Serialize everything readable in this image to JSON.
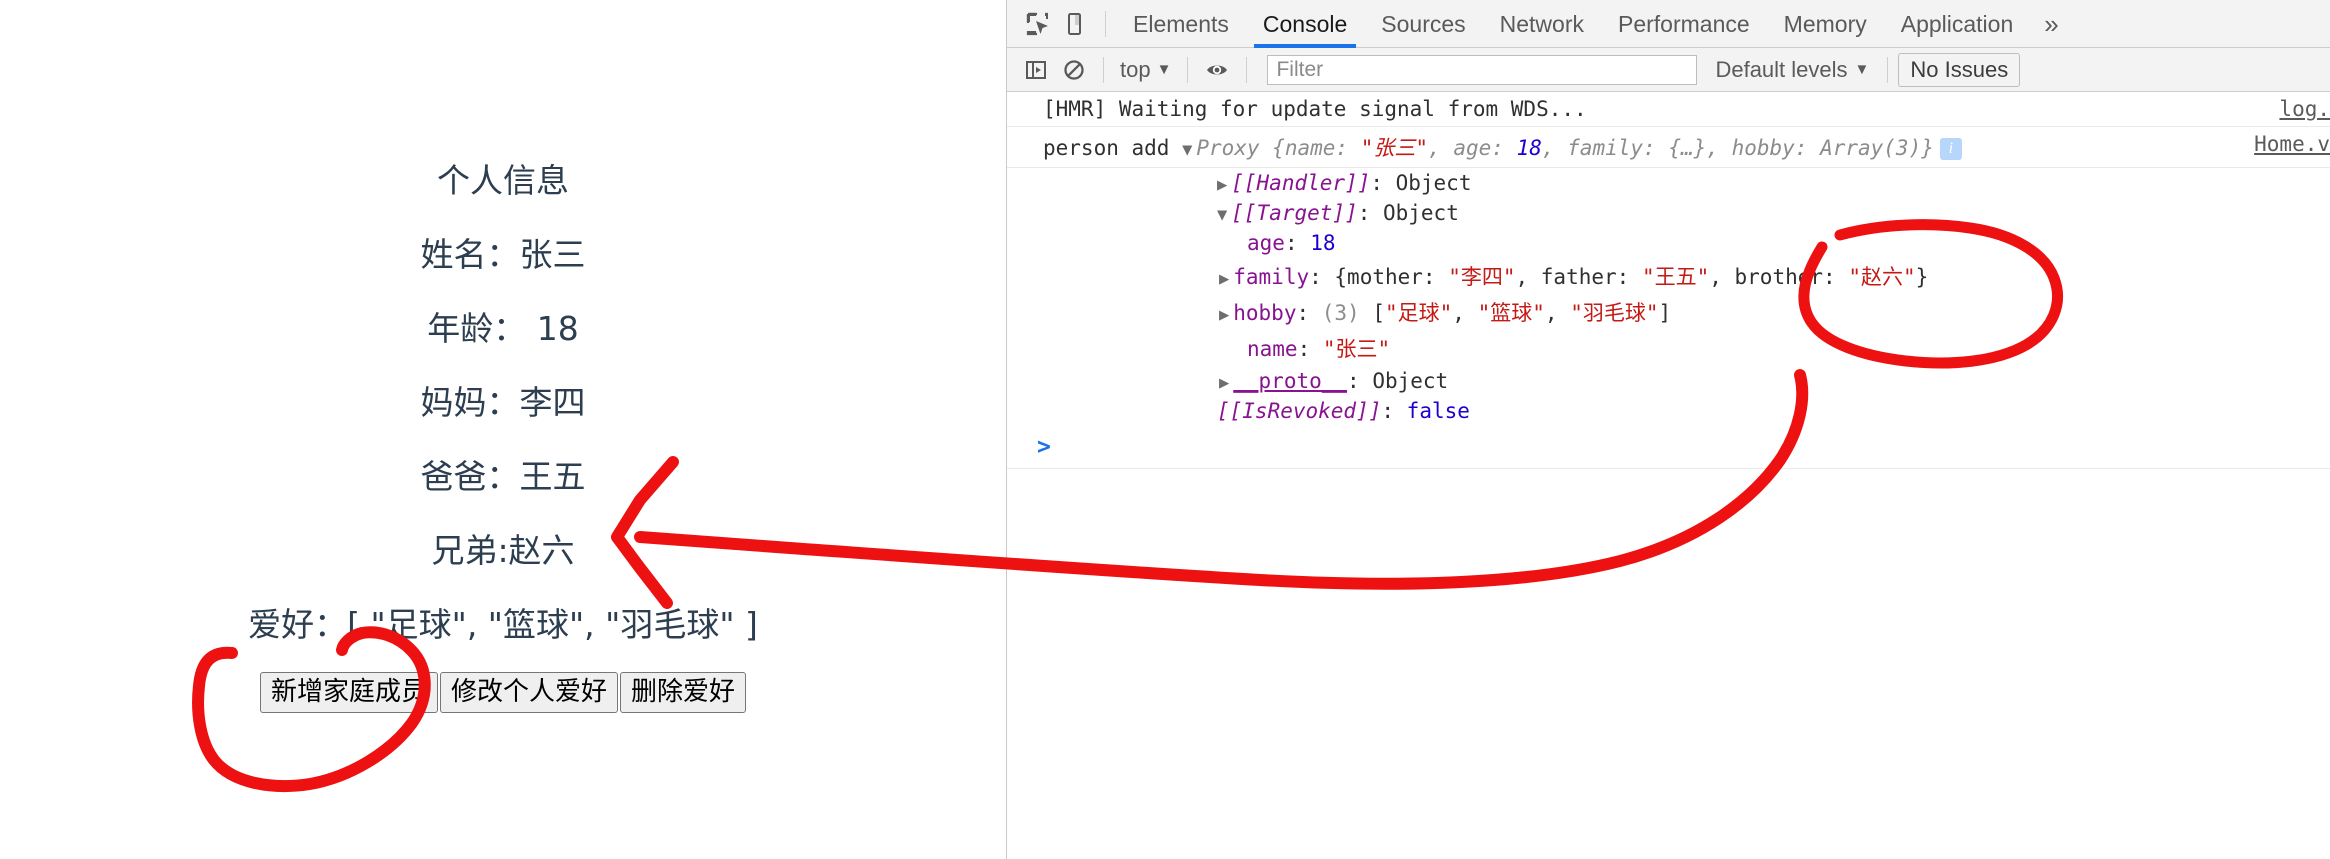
{
  "page": {
    "title": "个人信息",
    "rows": [
      "姓名：张三",
      "年龄： 18",
      "妈妈：李四",
      "爸爸：王五",
      "兄弟:赵六",
      "爱好：[ \"足球\", \"篮球\", \"羽毛球\" ]"
    ],
    "buttons": [
      "新增家庭成员",
      "修改个人爱好",
      "删除爱好"
    ]
  },
  "devtools": {
    "tabs": [
      {
        "label": "Elements",
        "active": false
      },
      {
        "label": "Console",
        "active": true
      },
      {
        "label": "Sources",
        "active": false
      },
      {
        "label": "Network",
        "active": false
      },
      {
        "label": "Performance",
        "active": false
      },
      {
        "label": "Memory",
        "active": false
      },
      {
        "label": "Application",
        "active": false
      }
    ],
    "more_label": "»",
    "icons": {
      "inspect": "inspect-element-icon",
      "device": "device-toolbar-icon",
      "sidebar": "console-sidebar-icon",
      "clear": "clear-console-icon",
      "eye": "live-expression-icon"
    },
    "toolbar": {
      "context": "top",
      "context_caret": "▼",
      "filter_placeholder": "Filter",
      "filter_value": "",
      "levels": "Default levels",
      "levels_caret": "▼",
      "issues": "No Issues"
    },
    "console": {
      "messages": [
        {
          "text": "[HMR] Waiting for update signal from WDS...",
          "source": "log."
        },
        {
          "prefix": "person add",
          "triangle": "▼",
          "preview_type": "Proxy ",
          "preview": "{name: \"张三\", age: 18, family: {…}, hobby: Array(3)}",
          "name_key": "name:",
          "name_val": "\"张三\"",
          "age_key": "age:",
          "age_val": "18",
          "family_key": "family:",
          "family_val": "{…}",
          "hobby_key": "hobby:",
          "hobby_val": "Array(3)",
          "source": "Home.v",
          "info_badge": "i"
        }
      ],
      "tree": {
        "handler_key": "[[Handler]]",
        "handler_val": ": Object",
        "target_key": "[[Target]]",
        "target_val": ": Object",
        "age_key": "age",
        "age_sep": ": ",
        "age_val": "18",
        "family_key": "family",
        "family_sep": ": {",
        "family_mother_key": "mother: ",
        "family_mother_val": "\"李四\"",
        "family_father_key": ", father: ",
        "family_father_val": "\"王五\"",
        "family_brother_key": ", brother: ",
        "family_brother_val": "\"赵六\"",
        "family_close": "}",
        "hobby_key": "hobby",
        "hobby_sep": ": ",
        "hobby_count": "(3) ",
        "hobby_open": "[",
        "hobby_1": "\"足球\"",
        "hobby_2": "\"篮球\"",
        "hobby_3": "\"羽毛球\"",
        "hobby_comma": ", ",
        "hobby_close": "]",
        "name_key": "name",
        "name_sep": ": ",
        "name_val": "\"张三\"",
        "proto_key": "__proto__",
        "proto_val": ": Object",
        "revoked_key": "[[IsRevoked]]",
        "revoked_sep": ": ",
        "revoked_val": "false"
      },
      "prompt": ">"
    }
  },
  "annotations": {
    "color": "#ee1111",
    "marks": [
      "circle-around-add-member-button",
      "long-arrow-from-console-to-page",
      "circle-around-brother-property"
    ]
  }
}
